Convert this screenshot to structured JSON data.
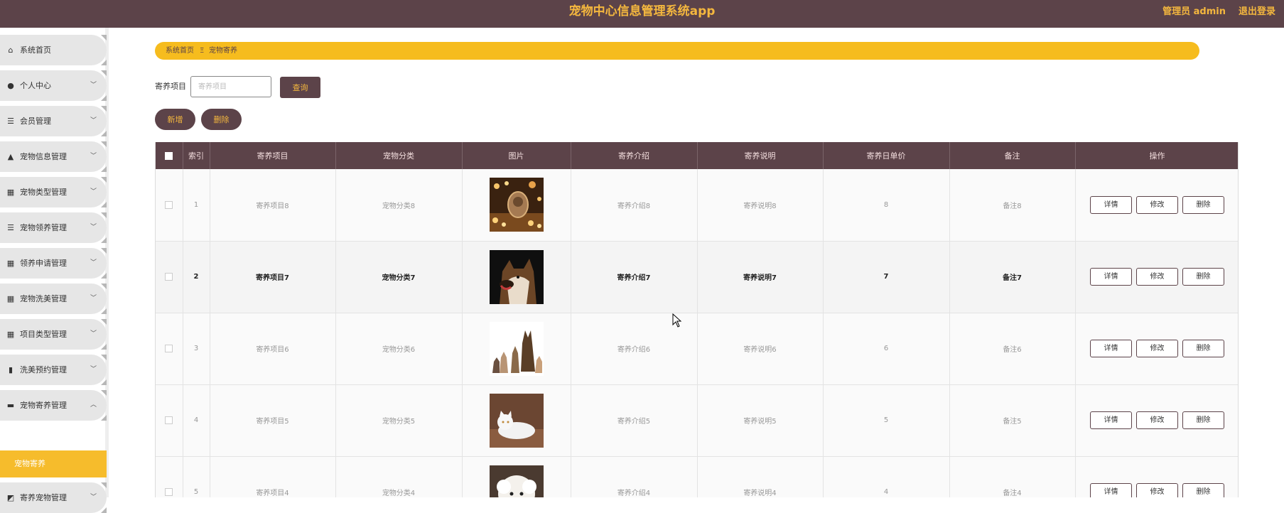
{
  "header": {
    "title": "宠物中心信息管理系统app",
    "admin": "管理员 admin",
    "logout": "退出登录"
  },
  "sidebar": {
    "items": [
      {
        "label": "系统首页",
        "icon": "home-icon",
        "has_arrow": false
      },
      {
        "label": "个人中心",
        "icon": "user-icon",
        "has_arrow": true
      },
      {
        "label": "会员管理",
        "icon": "list-icon",
        "has_arrow": true
      },
      {
        "label": "宠物信息管理",
        "icon": "thumbs-up-icon",
        "has_arrow": true
      },
      {
        "label": "宠物类型管理",
        "icon": "grid-icon",
        "has_arrow": true
      },
      {
        "label": "宠物领养管理",
        "icon": "list-icon",
        "has_arrow": true
      },
      {
        "label": "领养申请管理",
        "icon": "grid-icon",
        "has_arrow": true
      },
      {
        "label": "宠物洗美管理",
        "icon": "grid-icon",
        "has_arrow": true
      },
      {
        "label": "项目类型管理",
        "icon": "grid-icon",
        "has_arrow": true
      },
      {
        "label": "洗美预约管理",
        "icon": "book-icon",
        "has_arrow": true
      },
      {
        "label": "宠物寄养管理",
        "icon": "monitor-icon",
        "has_arrow": true,
        "expanded": true
      },
      {
        "label": "寄养宠物管理",
        "icon": "chart-icon",
        "has_arrow": true
      }
    ],
    "active_sub": "宠物寄养"
  },
  "breadcrumb": {
    "home": "系统首页",
    "sep": "Ξ",
    "current": "宠物寄养"
  },
  "search": {
    "label": "寄养项目",
    "placeholder": "寄养项目",
    "button": "查询"
  },
  "actions": {
    "add": "新增",
    "delete": "删除"
  },
  "table": {
    "headers": [
      "索引",
      "寄养项目",
      "宠物分类",
      "图片",
      "寄养介绍",
      "寄养说明",
      "寄养日单价",
      "备注",
      "操作"
    ],
    "rows": [
      {
        "index": "1",
        "item": "寄养项目8",
        "category": "宠物分类8",
        "intro": "寄养介绍8",
        "desc": "寄养说明8",
        "price": "8",
        "note": "备注8",
        "image": "cat-with-lights-photo"
      },
      {
        "index": "2",
        "item": "寄养项目7",
        "category": "宠物分类7",
        "intro": "寄养介绍7",
        "desc": "寄养说明7",
        "price": "7",
        "note": "备注7",
        "image": "husky-dog-photo"
      },
      {
        "index": "3",
        "item": "寄养项目6",
        "category": "宠物分类6",
        "intro": "寄养介绍6",
        "desc": "寄养说明6",
        "price": "6",
        "note": "备注6",
        "image": "dogs-and-cats-group-photo"
      },
      {
        "index": "4",
        "item": "寄养项目5",
        "category": "宠物分类5",
        "intro": "寄养介绍5",
        "desc": "寄养说明5",
        "price": "5",
        "note": "备注5",
        "image": "white-cat-photo"
      },
      {
        "index": "5",
        "item": "寄养项目4",
        "category": "宠物分类4",
        "intro": "寄养介绍4",
        "desc": "寄养说明4",
        "price": "4",
        "note": "备注4",
        "image": "white-poodle-photo"
      }
    ],
    "row_actions": {
      "detail": "详情",
      "edit": "修改",
      "delete": "删除"
    }
  },
  "colors": {
    "primary": "#5c4349",
    "accent": "#f6bc1e",
    "accent_text": "#f4b73e"
  }
}
